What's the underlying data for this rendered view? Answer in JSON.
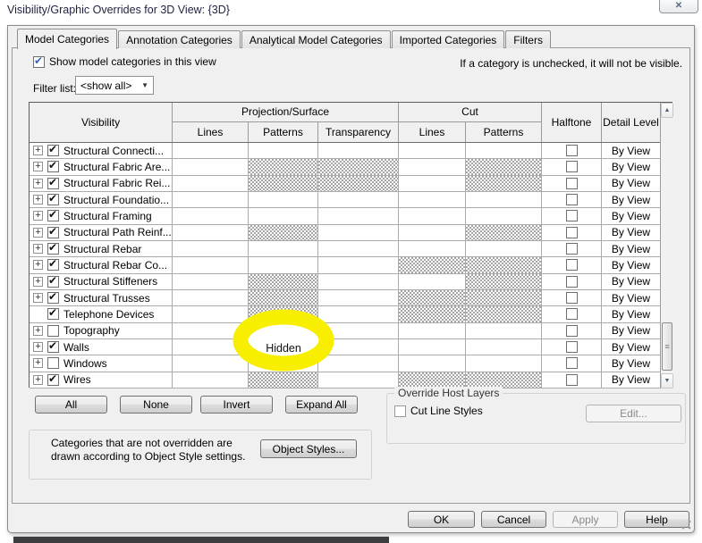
{
  "window": {
    "title": "Visibility/Graphic Overrides for 3D View: {3D}"
  },
  "icons": {
    "close": "✕",
    "check": "✔",
    "expand": "+",
    "dropdown_arrow": "▼",
    "scroll_up": "▲",
    "scroll_down": "▼",
    "thumb_grip": "≡"
  },
  "ui_colors": {
    "highlight_yellow": "#f7ee00",
    "hatch_gray": "#a6a6a6",
    "dialog_background": "#f0f0f0"
  },
  "tabs": [
    {
      "label": "Model Categories",
      "active": true
    },
    {
      "label": "Annotation Categories",
      "active": false
    },
    {
      "label": "Analytical Model Categories",
      "active": false
    },
    {
      "label": "Imported Categories",
      "active": false
    },
    {
      "label": "Filters",
      "active": false
    }
  ],
  "top_controls": {
    "show_checkbox_label": "Show model categories in this view",
    "show_checkbox_checked": true,
    "unchecked_note": "If a category is unchecked, it will not be visible.",
    "filter_label": "Filter list:",
    "filter_value": "<show all>"
  },
  "table": {
    "columns": {
      "visibility": "Visibility",
      "projection_surface": "Projection/Surface",
      "cut": "Cut",
      "ps_lines": "Lines",
      "ps_patterns": "Patterns",
      "ps_transparency": "Transparency",
      "cut_lines": "Lines",
      "cut_patterns": "Patterns",
      "halftone": "Halftone",
      "detail_level": "Detail Level"
    },
    "rows": [
      {
        "label": "Structural Connecti...",
        "expandable": true,
        "visible_checked": true,
        "ps_lines_hatched": false,
        "ps_patterns_hatched": false,
        "ps_patterns_text": "",
        "ps_transparency_hatched": false,
        "cut_lines_hatched": false,
        "cut_patterns_hatched": false,
        "halftone_checked": false,
        "detail_level": "By View"
      },
      {
        "label": "Structural Fabric Are...",
        "expandable": true,
        "visible_checked": true,
        "ps_lines_hatched": false,
        "ps_patterns_hatched": true,
        "ps_patterns_text": "",
        "ps_transparency_hatched": true,
        "cut_lines_hatched": false,
        "cut_patterns_hatched": true,
        "halftone_checked": false,
        "detail_level": "By View"
      },
      {
        "label": "Structural Fabric Rei...",
        "expandable": true,
        "visible_checked": true,
        "ps_lines_hatched": false,
        "ps_patterns_hatched": true,
        "ps_patterns_text": "",
        "ps_transparency_hatched": true,
        "cut_lines_hatched": false,
        "cut_patterns_hatched": true,
        "halftone_checked": false,
        "detail_level": "By View"
      },
      {
        "label": "Structural Foundatio...",
        "expandable": true,
        "visible_checked": true,
        "ps_lines_hatched": false,
        "ps_patterns_hatched": false,
        "ps_patterns_text": "",
        "ps_transparency_hatched": false,
        "cut_lines_hatched": false,
        "cut_patterns_hatched": false,
        "halftone_checked": false,
        "detail_level": "By View"
      },
      {
        "label": "Structural Framing",
        "expandable": true,
        "visible_checked": true,
        "ps_lines_hatched": false,
        "ps_patterns_hatched": false,
        "ps_patterns_text": "",
        "ps_transparency_hatched": false,
        "cut_lines_hatched": false,
        "cut_patterns_hatched": false,
        "halftone_checked": false,
        "detail_level": "By View"
      },
      {
        "label": "Structural Path Reinf...",
        "expandable": true,
        "visible_checked": true,
        "ps_lines_hatched": false,
        "ps_patterns_hatched": true,
        "ps_patterns_text": "",
        "ps_transparency_hatched": false,
        "cut_lines_hatched": false,
        "cut_patterns_hatched": true,
        "halftone_checked": false,
        "detail_level": "By View"
      },
      {
        "label": "Structural Rebar",
        "expandable": true,
        "visible_checked": true,
        "ps_lines_hatched": false,
        "ps_patterns_hatched": false,
        "ps_patterns_text": "",
        "ps_transparency_hatched": false,
        "cut_lines_hatched": false,
        "cut_patterns_hatched": false,
        "halftone_checked": false,
        "detail_level": "By View"
      },
      {
        "label": "Structural Rebar Co...",
        "expandable": true,
        "visible_checked": true,
        "ps_lines_hatched": false,
        "ps_patterns_hatched": false,
        "ps_patterns_text": "",
        "ps_transparency_hatched": false,
        "cut_lines_hatched": true,
        "cut_patterns_hatched": true,
        "halftone_checked": false,
        "detail_level": "By View"
      },
      {
        "label": "Structural Stiffeners",
        "expandable": true,
        "visible_checked": true,
        "ps_lines_hatched": false,
        "ps_patterns_hatched": true,
        "ps_patterns_text": "",
        "ps_transparency_hatched": false,
        "cut_lines_hatched": false,
        "cut_patterns_hatched": true,
        "halftone_checked": false,
        "detail_level": "By View"
      },
      {
        "label": "Structural Trusses",
        "expandable": true,
        "visible_checked": true,
        "ps_lines_hatched": false,
        "ps_patterns_hatched": true,
        "ps_patterns_text": "",
        "ps_transparency_hatched": false,
        "cut_lines_hatched": true,
        "cut_patterns_hatched": true,
        "halftone_checked": false,
        "detail_level": "By View"
      },
      {
        "label": "Telephone Devices",
        "expandable": false,
        "visible_checked": true,
        "ps_lines_hatched": false,
        "ps_patterns_hatched": true,
        "ps_patterns_text": "",
        "ps_transparency_hatched": false,
        "cut_lines_hatched": true,
        "cut_patterns_hatched": true,
        "halftone_checked": false,
        "detail_level": "By View"
      },
      {
        "label": "Topography",
        "expandable": true,
        "visible_checked": false,
        "ps_lines_hatched": false,
        "ps_patterns_hatched": false,
        "ps_patterns_text": "",
        "ps_transparency_hatched": false,
        "cut_lines_hatched": false,
        "cut_patterns_hatched": false,
        "halftone_checked": false,
        "detail_level": "By View"
      },
      {
        "label": "Walls",
        "expandable": true,
        "visible_checked": true,
        "ps_lines_hatched": false,
        "ps_patterns_hatched": false,
        "ps_patterns_text": "Hidden",
        "highlighted": true,
        "ps_transparency_hatched": false,
        "cut_lines_hatched": false,
        "cut_patterns_hatched": false,
        "halftone_checked": false,
        "detail_level": "By View"
      },
      {
        "label": "Windows",
        "expandable": true,
        "visible_checked": false,
        "ps_lines_hatched": false,
        "ps_patterns_hatched": false,
        "ps_patterns_text": "",
        "ps_transparency_hatched": false,
        "cut_lines_hatched": false,
        "cut_patterns_hatched": false,
        "halftone_checked": false,
        "detail_level": "By View"
      },
      {
        "label": "Wires",
        "expandable": true,
        "visible_checked": true,
        "ps_lines_hatched": false,
        "ps_patterns_hatched": true,
        "ps_patterns_text": "",
        "ps_transparency_hatched": false,
        "cut_lines_hatched": true,
        "cut_patterns_hatched": true,
        "halftone_checked": false,
        "detail_level": "By View"
      }
    ]
  },
  "list_buttons": {
    "all": "All",
    "none": "None",
    "invert": "Invert",
    "expand_all": "Expand All"
  },
  "override_host_layers": {
    "title": "Override Host Layers",
    "cut_line_styles_label": "Cut Line Styles",
    "cut_line_styles_checked": false,
    "edit_button": "Edit..."
  },
  "note_box": {
    "text": "Categories that are not overridden are drawn according to Object Style settings.",
    "object_styles_button": "Object Styles..."
  },
  "footer": {
    "ok": "OK",
    "cancel": "Cancel",
    "apply": "Apply",
    "help": "Help"
  }
}
